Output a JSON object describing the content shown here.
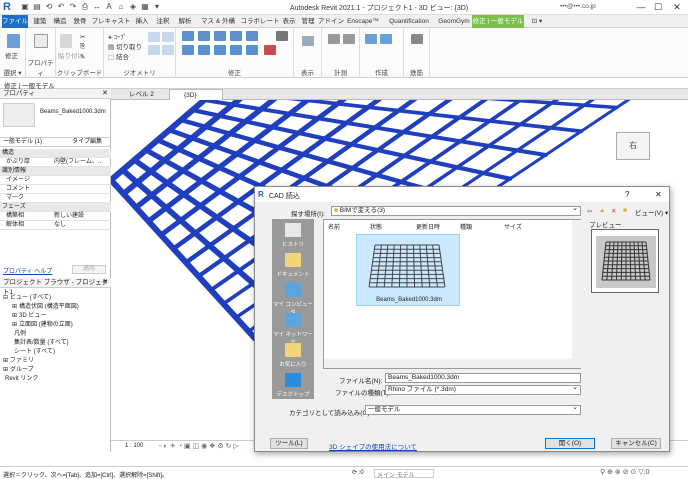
{
  "titlebar": {
    "app_logo": "R",
    "title": "Autodesk Revit 2021.1 - プロジェクト1 - 3D ビュー: {3D}",
    "user": "•••@•••.co.jp",
    "minimize": "—",
    "maximize": "☐",
    "close": "✕"
  },
  "ribbon_tabs": [
    "ファイル",
    "建築",
    "構造",
    "鉄骨",
    "プレキャスト",
    "挿入",
    "注釈",
    "解析",
    "マス & 外構",
    "コラボレート",
    "表示",
    "管理",
    "アドイン",
    "Enscape™",
    "Quantification",
    "GeomGym",
    "修正 | 一般モデル",
    "⊡ ▾"
  ],
  "ribbon_groups": [
    "選択 ▾",
    "プロパティ",
    "クリップボード",
    "ジオメトリ",
    "修正",
    "表示",
    "計測",
    "作成",
    "鉄筋"
  ],
  "ribbon_buttons": {
    "modify": "修正",
    "paste": "貼り付け",
    "cut": "切り取り",
    "join": "結合",
    "cope": "ｺｰﾌﾟ"
  },
  "context_bar": "修正 | 一般モデル",
  "properties": {
    "header": "プロパティ",
    "type_name": "Beams_Baked1000.3dm",
    "instance": "一般モデル (1)",
    "edit_type": "タイプ編集",
    "rows": [
      {
        "k": "構造",
        "v": "",
        "cat": true
      },
      {
        "k": "かぶり厚",
        "v": "内壁(フレーム、...",
        "cat": false
      },
      {
        "k": "識別情報",
        "v": "",
        "cat": true
      },
      {
        "k": "イメージ",
        "v": "",
        "cat": false
      },
      {
        "k": "コメント",
        "v": "",
        "cat": false
      },
      {
        "k": "マーク",
        "v": "",
        "cat": false
      },
      {
        "k": "フェーズ",
        "v": "",
        "cat": true
      },
      {
        "k": "構築相",
        "v": "新しい建設",
        "cat": false
      },
      {
        "k": "解体相",
        "v": "なし",
        "cat": false
      }
    ],
    "help_link": "プロパティ ヘルプ",
    "apply": "適用"
  },
  "browser": {
    "header": "プロジェクト ブラウザ - プロジェクト1",
    "items": [
      {
        "label": "ビュー (すべて)",
        "indent": 0,
        "icon": "⊟"
      },
      {
        "label": "構造伏図 (構造平面図)",
        "indent": 1,
        "icon": "⊞"
      },
      {
        "label": "3D ビュー",
        "indent": 1,
        "icon": "⊞"
      },
      {
        "label": "立面図 (建物の立面)",
        "indent": 1,
        "icon": "⊞"
      },
      {
        "label": "凡例",
        "indent": 1,
        "icon": ""
      },
      {
        "label": "集計表/数量 (すべて)",
        "indent": 1,
        "icon": ""
      },
      {
        "label": "シート (すべて)",
        "indent": 1,
        "icon": ""
      },
      {
        "label": "ファミリ",
        "indent": 0,
        "icon": "⊞"
      },
      {
        "label": "グループ",
        "indent": 0,
        "icon": "⊞"
      },
      {
        "label": "Revit リンク",
        "indent": 0,
        "icon": ""
      }
    ]
  },
  "view_tabs": [
    {
      "label": "レベル 2",
      "active": false
    },
    {
      "label": "{3D}",
      "active": true
    }
  ],
  "viewcube_label": "右",
  "viewbar": {
    "scale": "1 : 100"
  },
  "status": {
    "hint": "選択＝クリック、次へ=[Tab]、追加=[Ctrl]、選択解除=[Shift]。",
    "model": "メイン モデル",
    "zero": ":0"
  },
  "dialog": {
    "title": "CAD 読込",
    "help": "?",
    "close": "✕",
    "look_in_label": "探す場所(I):",
    "look_in_value": "BIMで変える(3)",
    "toolbar": [
      "⇦",
      "📁",
      "✕",
      "📁",
      "ビュー(V) ▾"
    ],
    "preview_label": "プレビュー",
    "places": [
      "ヒストリ",
      "ドキュメント",
      "マイ コンピュータ",
      "マイ ネットワーク",
      "お気に入り",
      "デスクトップ"
    ],
    "columns": [
      "名前",
      "状態",
      "更新日時",
      "種類",
      "サイズ"
    ],
    "file_item": "Beams_Baked1000.3dm",
    "filename_label": "ファイル名(N):",
    "filename_value": "Beams_Baked1000.3dm",
    "filetype_label": "ファイルの種類(T):",
    "filetype_value": "Rhino ファイル (*.3dm)",
    "category_label": "カテゴリとして読み込み(G):",
    "category_value": "一般モデル",
    "tools_button": "ツール(L)",
    "link": "3D シェイプの使用法について",
    "open_button": "開く(O)",
    "cancel_button": "キャンセル(C)"
  },
  "colors": {
    "accent": "#1d6fc5",
    "context_tab": "#7bbf4b",
    "beam_blue": "#1f3fbf",
    "selection": "#cce8ff"
  }
}
